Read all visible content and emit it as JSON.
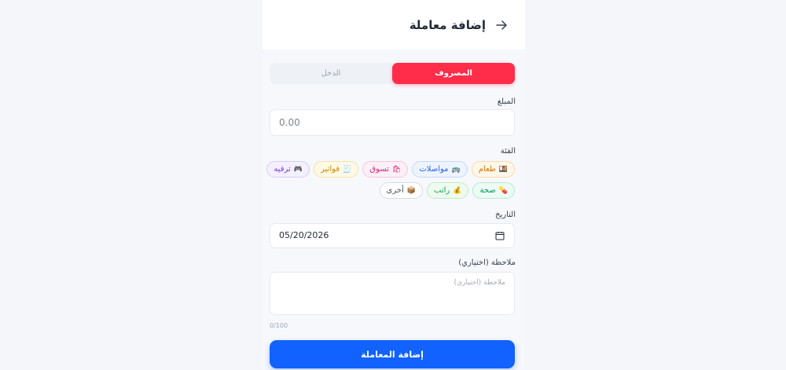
{
  "header": {
    "title": "إضافة معاملة",
    "back_icon": "arrow-right-icon"
  },
  "tabs": [
    {
      "label": "المصروف",
      "active": true
    },
    {
      "label": "الدخل",
      "active": false
    }
  ],
  "amount": {
    "label": "المبلغ",
    "placeholder": "0.00"
  },
  "category": {
    "label": "الفئة",
    "row1": [
      {
        "icon": "🍱",
        "label": "طعام",
        "fg": "#d97706",
        "bg": "#fff7ea",
        "border": "#fcd9a8"
      },
      {
        "icon": "🚌",
        "label": "مواصلات",
        "fg": "#2563eb",
        "bg": "#eef4ff",
        "border": "#c7d7fb"
      },
      {
        "icon": "🛍",
        "label": "تسوق",
        "fg": "#db2777",
        "bg": "#fdf0f6",
        "border": "#f7c5dc"
      },
      {
        "icon": "🧾",
        "label": "فواتير",
        "fg": "#ca8a04",
        "bg": "#fff9e6",
        "border": "#f6e2a0"
      },
      {
        "icon": "🎮",
        "label": "ترفيه",
        "fg": "#7c3aed",
        "bg": "#f5f0ff",
        "border": "#d9c9fb"
      }
    ],
    "row2": [
      {
        "icon": "💊",
        "label": "صحة",
        "fg": "#059669",
        "bg": "#ecfbf4",
        "border": "#b3ecd2"
      },
      {
        "icon": "💰",
        "label": "راتب",
        "fg": "#16a34a",
        "bg": "#eefbf1",
        "border": "#bfeac8"
      },
      {
        "icon": "📦",
        "label": "أخرى",
        "fg": "#4b5563",
        "bg": "#ffffff",
        "border": "#d6dae0"
      }
    ]
  },
  "date": {
    "label": "التاريخ",
    "value": "05/20/2026"
  },
  "note": {
    "label": "ملاحظة (اختياري)",
    "placeholder": "ملاحظة (اختياري)",
    "counter": "0/100"
  },
  "submit": {
    "label": "إضافة المعاملة"
  },
  "colors": {
    "expense": "#ff2d4a",
    "primary": "#1162ff"
  }
}
